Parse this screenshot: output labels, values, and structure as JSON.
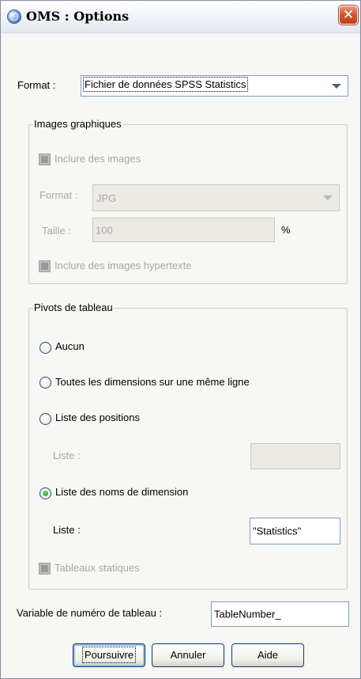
{
  "window": {
    "title": "OMS : Options",
    "close_glyph": "✕"
  },
  "format": {
    "label": "Format :",
    "value": "Fichier de données SPSS Statistics"
  },
  "images_group": {
    "legend": "Images graphiques",
    "include_images": "Inclure des images",
    "format_label": "Format :",
    "format_value": "JPG",
    "size_label": "Taille :",
    "size_value": "100",
    "size_unit": "%",
    "include_hypertext": "Inclure des images hypertexte"
  },
  "pivot_group": {
    "legend": "Pivots de tableau",
    "options": [
      {
        "label": "Aucun",
        "selected": false
      },
      {
        "label": "Toutes les dimensions sur une même ligne",
        "selected": false
      },
      {
        "label": "Liste des positions",
        "selected": false
      },
      {
        "label": "Liste des noms de dimension",
        "selected": true
      }
    ],
    "positions_list_label": "Liste :",
    "positions_list_value": "",
    "names_list_label": "Liste :",
    "names_list_value": "\"Statistics\"",
    "static_tables": "Tableaux statiques"
  },
  "table_number": {
    "label": "Variable de numéro de tableau :",
    "value": "TableNumber_"
  },
  "buttons": {
    "continue": "Poursuivre",
    "cancel": "Annuler",
    "help": "Aide"
  }
}
